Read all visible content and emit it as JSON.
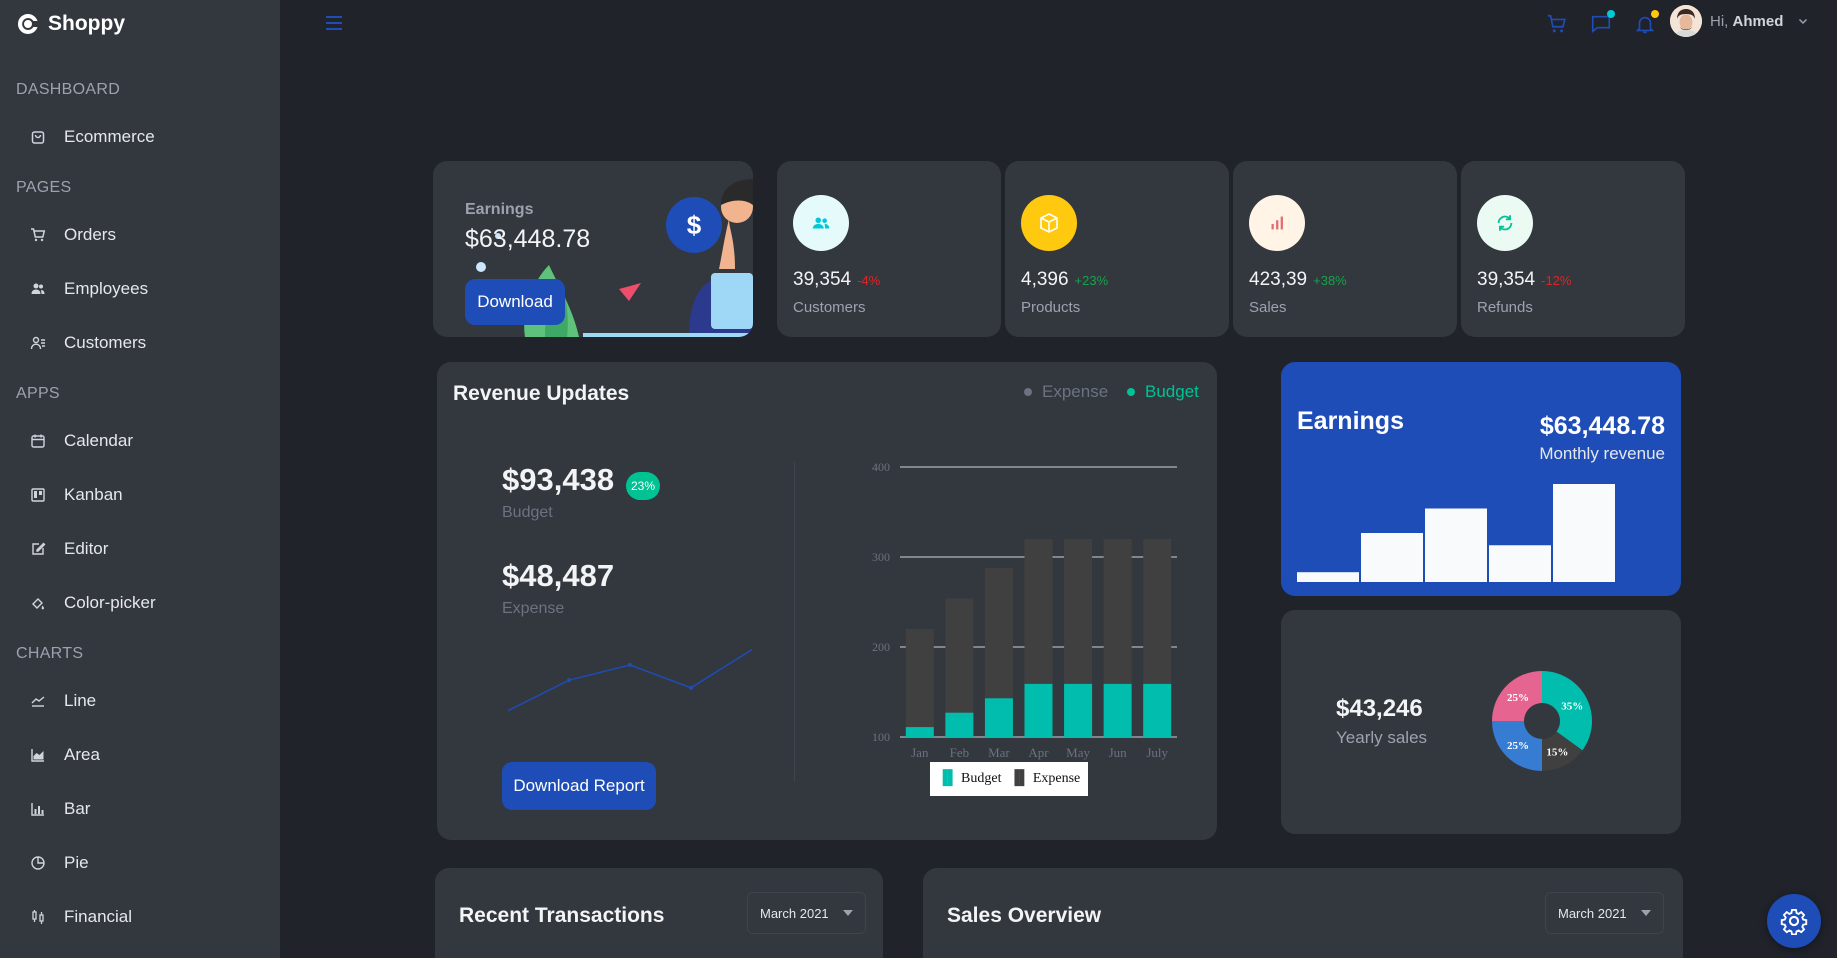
{
  "brand": {
    "name": "Shoppy"
  },
  "sidebar": {
    "sections": [
      {
        "title": "DASHBOARD",
        "items": [
          {
            "label": "Ecommerce",
            "icon": "shopping-bag-icon"
          }
        ]
      },
      {
        "title": "PAGES",
        "items": [
          {
            "label": "Orders",
            "icon": "cart-icon"
          },
          {
            "label": "Employees",
            "icon": "employees-icon"
          },
          {
            "label": "Customers",
            "icon": "customers-icon"
          }
        ]
      },
      {
        "title": "APPS",
        "items": [
          {
            "label": "Calendar",
            "icon": "calendar-icon"
          },
          {
            "label": "Kanban",
            "icon": "kanban-icon"
          },
          {
            "label": "Editor",
            "icon": "editor-icon"
          },
          {
            "label": "Color-picker",
            "icon": "color-picker-icon"
          }
        ]
      },
      {
        "title": "CHARTS",
        "items": [
          {
            "label": "Line",
            "icon": "line-chart-icon"
          },
          {
            "label": "Area",
            "icon": "area-chart-icon"
          },
          {
            "label": "Bar",
            "icon": "bar-chart-icon"
          },
          {
            "label": "Pie",
            "icon": "pie-chart-icon"
          },
          {
            "label": "Financial",
            "icon": "financial-icon"
          }
        ]
      }
    ]
  },
  "topbar": {
    "greeting": "Hi,",
    "user_name": "Ahmed",
    "accent_color": "#1e4db7",
    "chat_dot_color": "#03c9d7",
    "bell_dot_color": "#fec90f"
  },
  "earnings_card": {
    "label": "Earnings",
    "value": "$63,448.78",
    "button": "Download"
  },
  "stats": [
    {
      "value": "39,354",
      "pct": "-4%",
      "label": "Customers",
      "icon": "customers-icon",
      "icon_color": "#03c9d7",
      "bg": "#e5fafb",
      "pct_color": "#dc2626"
    },
    {
      "value": "4,396",
      "pct": "+23%",
      "label": "Products",
      "icon": "box-icon",
      "icon_color": "#ffffff",
      "bg": "#fec90f",
      "pct_color": "#16a34a"
    },
    {
      "value": "423,39",
      "pct": "+38%",
      "label": "Sales",
      "icon": "bar-chart-icon",
      "icon_color": "#e46a76",
      "bg": "#fff4e5",
      "pct_color": "#16a34a"
    },
    {
      "value": "39,354",
      "pct": "-12%",
      "label": "Refunds",
      "icon": "refresh-icon",
      "icon_color": "#00c292",
      "bg": "#ebfaf2",
      "pct_color": "#dc2626"
    }
  ],
  "revenue": {
    "title": "Revenue Updates",
    "legend_expense": "Expense",
    "legend_budget": "Budget",
    "budget_value": "$93,438",
    "budget_badge": "23%",
    "budget_label": "Budget",
    "expense_value": "$48,487",
    "expense_label": "Expense",
    "button": "Download Report",
    "chart_legend_budget": "Budget",
    "chart_legend_expense": "Expense"
  },
  "earnings_panel": {
    "title": "Earnings",
    "value": "$63,448.78",
    "sub": "Monthly revenue"
  },
  "yearly": {
    "value": "$43,246",
    "label": "Yearly sales"
  },
  "transactions": {
    "title": "Recent Transactions",
    "select": "March 2021"
  },
  "sales_overview": {
    "title": "Sales Overview",
    "select": "March 2021"
  },
  "chart_data": [
    {
      "type": "line",
      "title": "",
      "x": [
        1,
        2,
        3,
        4,
        5
      ],
      "series": [
        {
          "values": [
            2,
            6,
            8,
            5,
            10
          ]
        }
      ]
    },
    {
      "type": "bar",
      "title": "",
      "categories": [
        "Jan",
        "Feb",
        "Mar",
        "Apr",
        "May",
        "Jun",
        "July"
      ],
      "series": [
        {
          "name": "Budget",
          "values": [
            111,
            127,
            143,
            159,
            159,
            159,
            159
          ],
          "color": "#00bdae"
        },
        {
          "name": "Expense",
          "values": [
            220,
            254,
            288,
            320,
            320,
            320,
            320
          ],
          "color": "#404041"
        }
      ],
      "ylim": [
        100,
        400
      ],
      "yticks": [
        100,
        200,
        300,
        400
      ],
      "grid": true,
      "legend": "bottom"
    },
    {
      "type": "bar",
      "title": "",
      "values": [
        4,
        20,
        30,
        15,
        40
      ],
      "color": "#f8fafc"
    },
    {
      "type": "pie",
      "title": "",
      "labels": [
        "35%",
        "15%",
        "25%",
        "25%"
      ],
      "values": [
        35,
        15,
        25,
        25
      ],
      "colors": [
        "#00bdae",
        "#404041",
        "#357cd2",
        "#e56590"
      ]
    }
  ]
}
